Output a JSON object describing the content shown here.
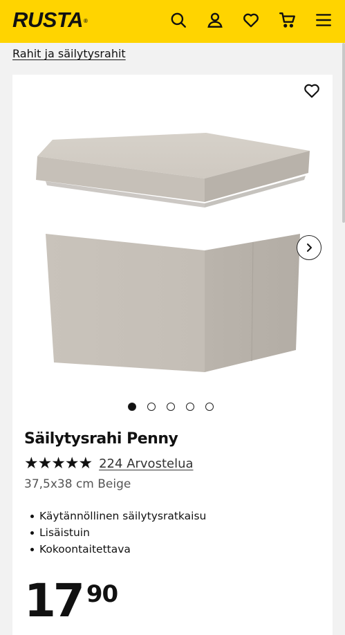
{
  "header": {
    "logo_text": "RUSTA",
    "logo_mark": "®",
    "icons": [
      "search-icon",
      "account-icon",
      "wishlist-icon",
      "cart-icon",
      "menu-icon"
    ],
    "background_color": "#ffd400"
  },
  "breadcrumb": {
    "label": "Rahit ja säilytysrahit"
  },
  "product": {
    "title": "Säilytysrahi Penny",
    "stars_display": "★★★★★",
    "rating_stars": 5,
    "reviews_label": "224 Arvostelua",
    "variant": "37,5x38 cm Beige",
    "features": [
      "Käytännöllinen säilytysratkaisu",
      "Lisäistuin",
      "Kokoontaitettava"
    ],
    "price": {
      "whole": "17",
      "cents": "90"
    },
    "gallery": {
      "image_count": 5,
      "active_index": 0
    }
  }
}
